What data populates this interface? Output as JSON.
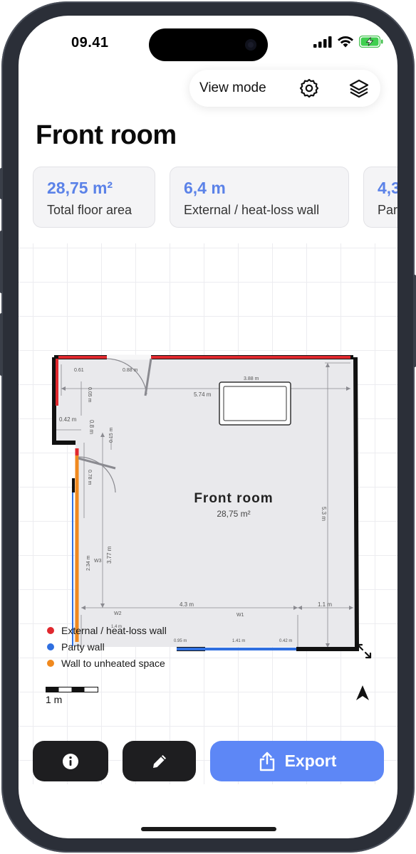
{
  "status_bar": {
    "time": "09.41"
  },
  "toolbar": {
    "view_mode_label": "View mode",
    "settings_icon": "gear-icon",
    "layers_icon": "layers-icon"
  },
  "page_title": "Front room",
  "stats": [
    {
      "value": "28,75 m²",
      "label": "Total floor area"
    },
    {
      "value": "6,4 m",
      "label": "External / heat-loss wall"
    },
    {
      "value": "4,3",
      "label": "Par"
    }
  ],
  "floorplan": {
    "room_name": "Front room",
    "room_area": "28,75 m²",
    "dimensions": {
      "top_opening": "0.88 m",
      "top_left_a": "0.61",
      "top_left_b": "0.05 m",
      "window_width": "3.88 m",
      "width_top": "5.74 m",
      "alcove_width": "0.42 m",
      "alcove_depth": "0.8 m",
      "small_gap": "0.15 m",
      "door_width": "0.78 m",
      "left_height": "3.77 m",
      "left_lower": "2.34 m",
      "right_height": "5.3 m",
      "bottom_width": "4.3 m",
      "bottom_right": "1.1 m",
      "bottom_a": "1.4 m",
      "bottom_b": "0.95 m",
      "bottom_c": "1.41 m",
      "bottom_d": "0.42 m"
    },
    "wall_labels": {
      "w1": "W1",
      "w2": "W2",
      "w3": "W3"
    }
  },
  "legend": [
    {
      "label": "External / heat-loss wall",
      "color": "#e0282e"
    },
    {
      "label": "Party wall",
      "color": "#2f6fe0"
    },
    {
      "label": "Wall to unheated space",
      "color": "#f0891e"
    }
  ],
  "scale_bar": {
    "label": "1 m"
  },
  "actions": {
    "info_icon": "info-icon",
    "edit_icon": "pencil-icon",
    "export_label": "Export",
    "export_icon": "share-icon"
  },
  "colors": {
    "accent": "#5d87f6",
    "stat_value": "#5b82e8",
    "external_wall": "#e0282e",
    "party_wall": "#2f6fe0",
    "unheated_wall": "#f0891e"
  }
}
